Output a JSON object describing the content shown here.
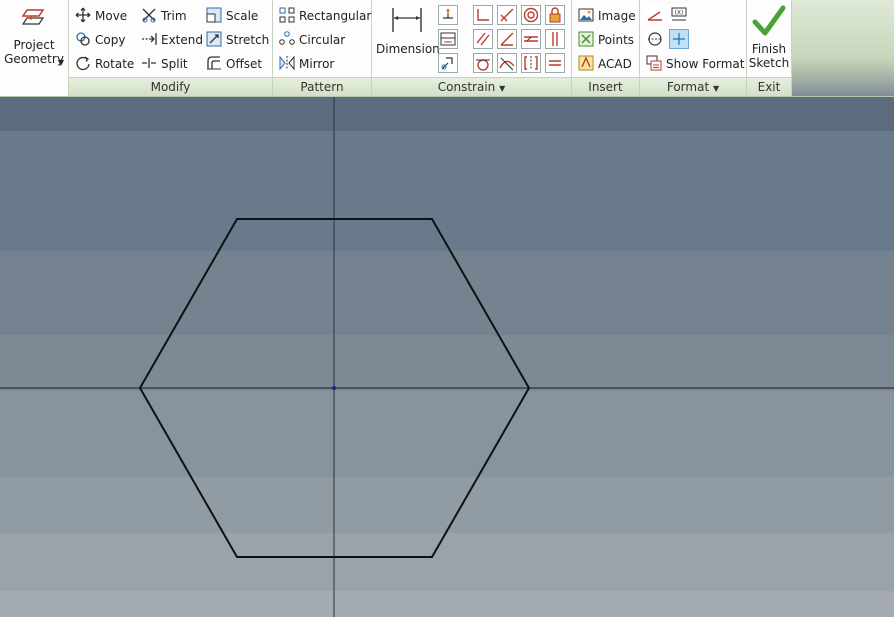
{
  "ribbon": {
    "project": {
      "line1": "Project",
      "line2": "Geometry"
    },
    "modify": {
      "title": "Modify",
      "col1": [
        "Move",
        "Copy",
        "Rotate"
      ],
      "col2": [
        "Trim",
        "Extend",
        "Split"
      ],
      "col3": [
        "Scale",
        "Stretch",
        "Offset"
      ]
    },
    "pattern": {
      "title": "Pattern",
      "items": [
        "Rectangular",
        "Circular",
        "Mirror"
      ]
    },
    "constrain": {
      "title": "Constrain",
      "dimension": "Dimension"
    },
    "insert": {
      "title": "Insert",
      "items": [
        "Image",
        "Points",
        "ACAD"
      ]
    },
    "format": {
      "title": "Format",
      "show_format": "Show Format"
    },
    "exit": {
      "title": "Exit",
      "line1": "Finish",
      "line2": "Sketch"
    }
  },
  "colors": {
    "canvas_top": "#5c6e80",
    "canvas_bottom": "#a3aab2",
    "sketch_line": "#111111",
    "axis_line": "#333333",
    "ribbon_accent": "#d2e0c6",
    "finish_check": "#4aa236",
    "constraint_red": "#c0392b"
  }
}
